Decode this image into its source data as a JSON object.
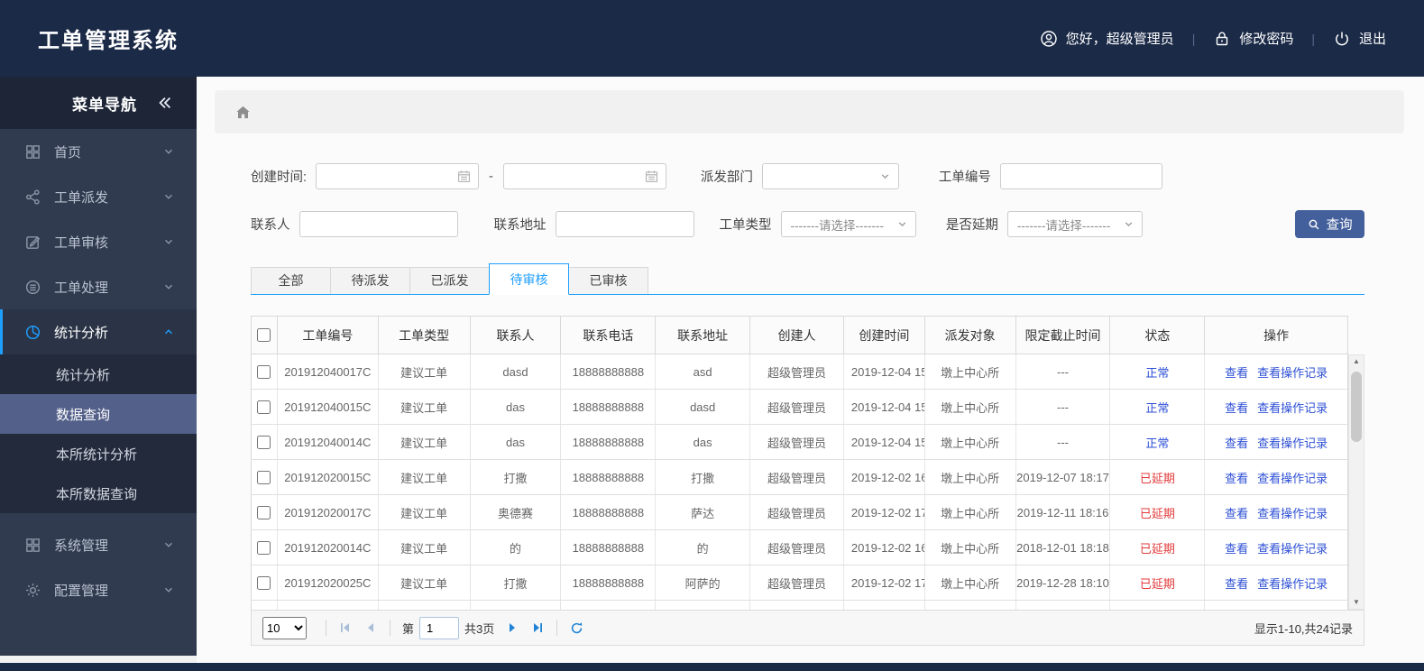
{
  "colors": {
    "header_bg": "#1b2a47",
    "sidebar_bg": "#313b4f",
    "accent_blue": "#1E9FFF",
    "link_blue": "#2d4fd5",
    "status_normal": "#2d4fd5",
    "status_overdue": "#e23a3a",
    "search_button_bg": "#44609c"
  },
  "header": {
    "title": "工单管理系统",
    "greeting": "您好，超级管理员",
    "change_password": "修改密码",
    "logout": "退出",
    "icons": [
      "user-icon",
      "lock-icon",
      "power-icon"
    ]
  },
  "sidebar": {
    "title": "菜单导航",
    "collapse_icon": "double-chevron-left-icon",
    "menu_top": [
      {
        "label": "首页",
        "icon": "grid-icon"
      },
      {
        "label": "工单派发",
        "icon": "share-icon"
      },
      {
        "label": "工单审核",
        "icon": "edit-icon"
      },
      {
        "label": "工单处理",
        "icon": "process-icon"
      }
    ],
    "menu_active": {
      "label": "统计分析",
      "icon": "pie-chart-icon"
    },
    "submenu": [
      {
        "label": "统计分析"
      },
      {
        "label": "数据查询",
        "selected": true
      },
      {
        "label": "本所统计分析"
      },
      {
        "label": "本所数据查询"
      }
    ],
    "menu_bottom": [
      {
        "label": "系统管理",
        "icon": "squares-icon"
      },
      {
        "label": "配置管理",
        "icon": "gear-icon"
      }
    ]
  },
  "breadcrumb": {
    "home_icon": "home-icon"
  },
  "filters": {
    "create_time_label": "创建时间:",
    "date_separator": "-",
    "dispatch_dept_label": "派发部门",
    "order_no_label": "工单编号",
    "contact_label": "联系人",
    "address_label": "联系地址",
    "order_type_label": "工单类型",
    "delay_label": "是否延期",
    "select_placeholder": "-------请选择-------",
    "search_button": "查询"
  },
  "tabs": [
    {
      "label": "全部"
    },
    {
      "label": "待派发"
    },
    {
      "label": "已派发"
    },
    {
      "label": "待审核",
      "active": true
    },
    {
      "label": "已审核"
    }
  ],
  "table": {
    "columns": [
      "工单编号",
      "工单类型",
      "联系人",
      "联系电话",
      "联系地址",
      "创建人",
      "创建时间",
      "派发对象",
      "限定截止时间",
      "状态",
      "操作"
    ],
    "ops": {
      "view": "查看",
      "view_log": "查看操作记录"
    },
    "rows": [
      {
        "order_no": "201912040017C",
        "type": "建议工单",
        "contact": "dasd",
        "phone": "18888888888",
        "address": "asd",
        "creator": "超级管理员",
        "created": "2019-12-04 15",
        "target": "墩上中心所",
        "deadline": "---",
        "status": "正常",
        "status_type": "normal"
      },
      {
        "order_no": "201912040015C",
        "type": "建议工单",
        "contact": "das",
        "phone": "18888888888",
        "address": "dasd",
        "creator": "超级管理员",
        "created": "2019-12-04 15",
        "target": "墩上中心所",
        "deadline": "---",
        "status": "正常",
        "status_type": "normal"
      },
      {
        "order_no": "201912040014C",
        "type": "建议工单",
        "contact": "das",
        "phone": "18888888888",
        "address": "das",
        "creator": "超级管理员",
        "created": "2019-12-04 15",
        "target": "墩上中心所",
        "deadline": "---",
        "status": "正常",
        "status_type": "normal"
      },
      {
        "order_no": "201912020015C",
        "type": "建议工单",
        "contact": "打撒",
        "phone": "18888888888",
        "address": "打撒",
        "creator": "超级管理员",
        "created": "2019-12-02 16",
        "target": "墩上中心所",
        "deadline": "2019-12-07 18:17",
        "status": "已延期",
        "status_type": "overdue"
      },
      {
        "order_no": "201912020017C",
        "type": "建议工单",
        "contact": "奥德赛",
        "phone": "18888888888",
        "address": "萨达",
        "creator": "超级管理员",
        "created": "2019-12-02 17",
        "target": "墩上中心所",
        "deadline": "2019-12-11 18:16",
        "status": "已延期",
        "status_type": "overdue"
      },
      {
        "order_no": "201912020014C",
        "type": "建议工单",
        "contact": "的",
        "phone": "18888888888",
        "address": "的",
        "creator": "超级管理员",
        "created": "2019-12-02 16",
        "target": "墩上中心所",
        "deadline": "2018-12-01 18:18",
        "status": "已延期",
        "status_type": "overdue"
      },
      {
        "order_no": "201912020025C",
        "type": "建议工单",
        "contact": "打撒",
        "phone": "18888888888",
        "address": "阿萨的",
        "creator": "超级管理员",
        "created": "2019-12-02 17",
        "target": "墩上中心所",
        "deadline": "2019-12-28 18:10",
        "status": "已延期",
        "status_type": "overdue"
      }
    ]
  },
  "pagination": {
    "page_size": "10",
    "page_prefix": "第",
    "page": "1",
    "page_total": "共3页",
    "summary": "显示1-10,共24记录",
    "icons": [
      "first-page-icon",
      "prev-page-icon",
      "next-page-icon",
      "last-page-icon",
      "refresh-icon"
    ]
  }
}
